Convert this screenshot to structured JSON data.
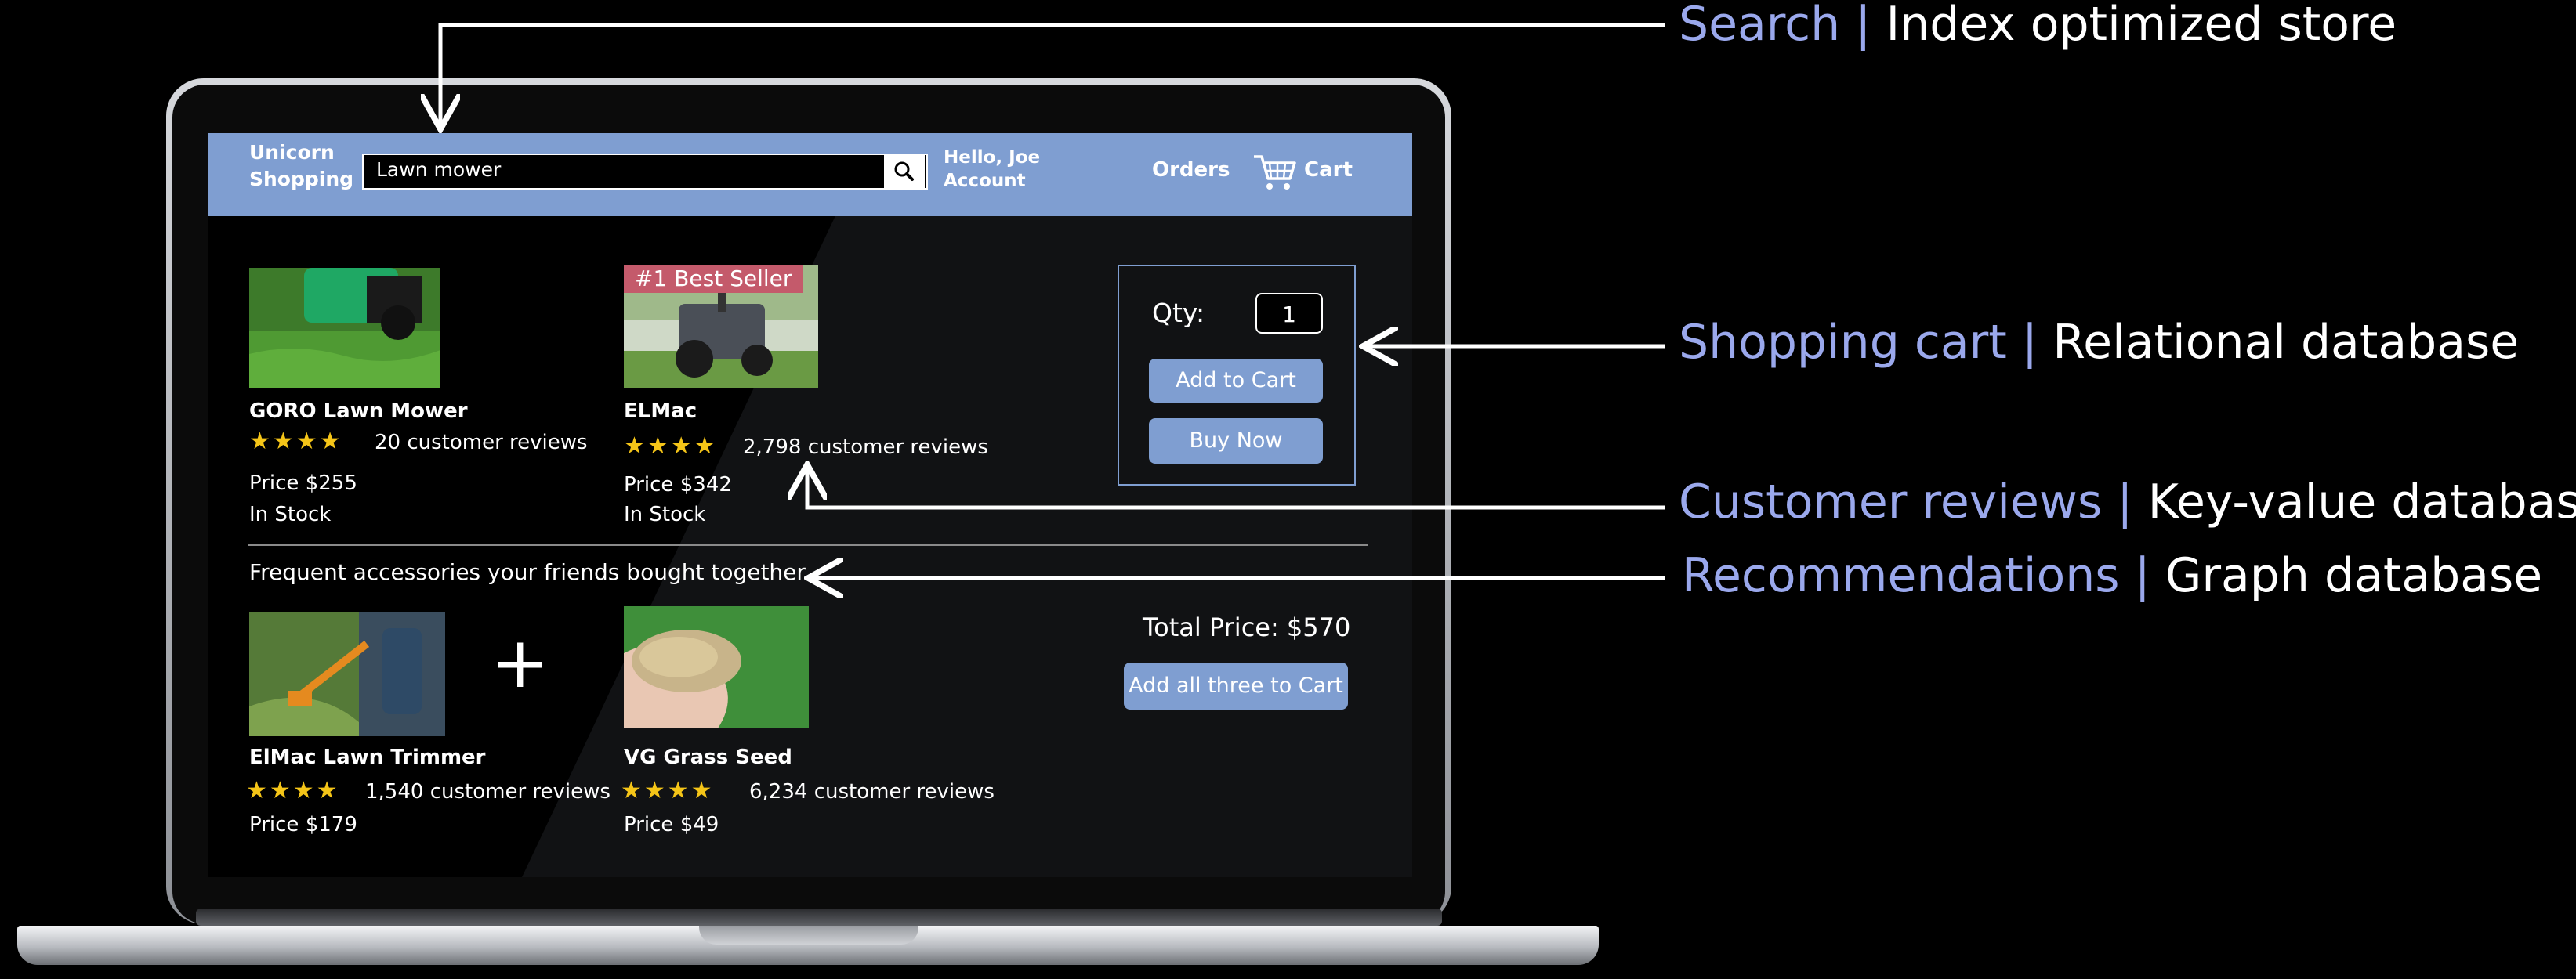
{
  "annotations": [
    {
      "key": "Search",
      "value": "Index optimized store"
    },
    {
      "key": "Shopping cart",
      "value": "Relational database"
    },
    {
      "key": "Customer reviews",
      "value": "Key-value database"
    },
    {
      "key": "Recommendations",
      "value": "Graph database"
    }
  ],
  "separator": "|",
  "header": {
    "brand_line1": "Unicorn",
    "brand_line2": "Shopping",
    "search_value": "Lawn mower",
    "hello_line1": "Hello, Joe",
    "hello_line2": "Account",
    "orders": "Orders",
    "cart": "Cart"
  },
  "products": [
    {
      "name": "GORO Lawn Mower",
      "stars": "★★★★",
      "reviews": "20 customer reviews",
      "price": "Price $255",
      "stock": "In Stock"
    },
    {
      "name": "ELMac",
      "stars": "★★★★",
      "reviews": "2,798 customer reviews",
      "price": "Price $342",
      "stock": "In Stock",
      "badge": "#1 Best Seller"
    }
  ],
  "purchase": {
    "qty_label": "Qty:",
    "qty_value": "1",
    "add_to_cart": "Add to Cart",
    "buy_now": "Buy Now"
  },
  "accessories": {
    "heading": "Frequent accessories your friends bought together",
    "plus": "+",
    "items": [
      {
        "name": "ElMac Lawn Trimmer",
        "stars": "★★★★",
        "reviews": "1,540 customer reviews",
        "price": "Price $179"
      },
      {
        "name": "VG Grass Seed",
        "stars": "★★★★",
        "reviews": "6,234 customer reviews",
        "price": "Price $49"
      }
    ],
    "total": "Total Price: $570",
    "add_all": "Add all three to Cart"
  },
  "colors": {
    "accent": "#7f9ed1",
    "annotation_key": "#9aa8ec",
    "badge": "#c45a6b",
    "star": "#f5c518"
  },
  "icons": [
    "search-icon",
    "cart-icon"
  ]
}
